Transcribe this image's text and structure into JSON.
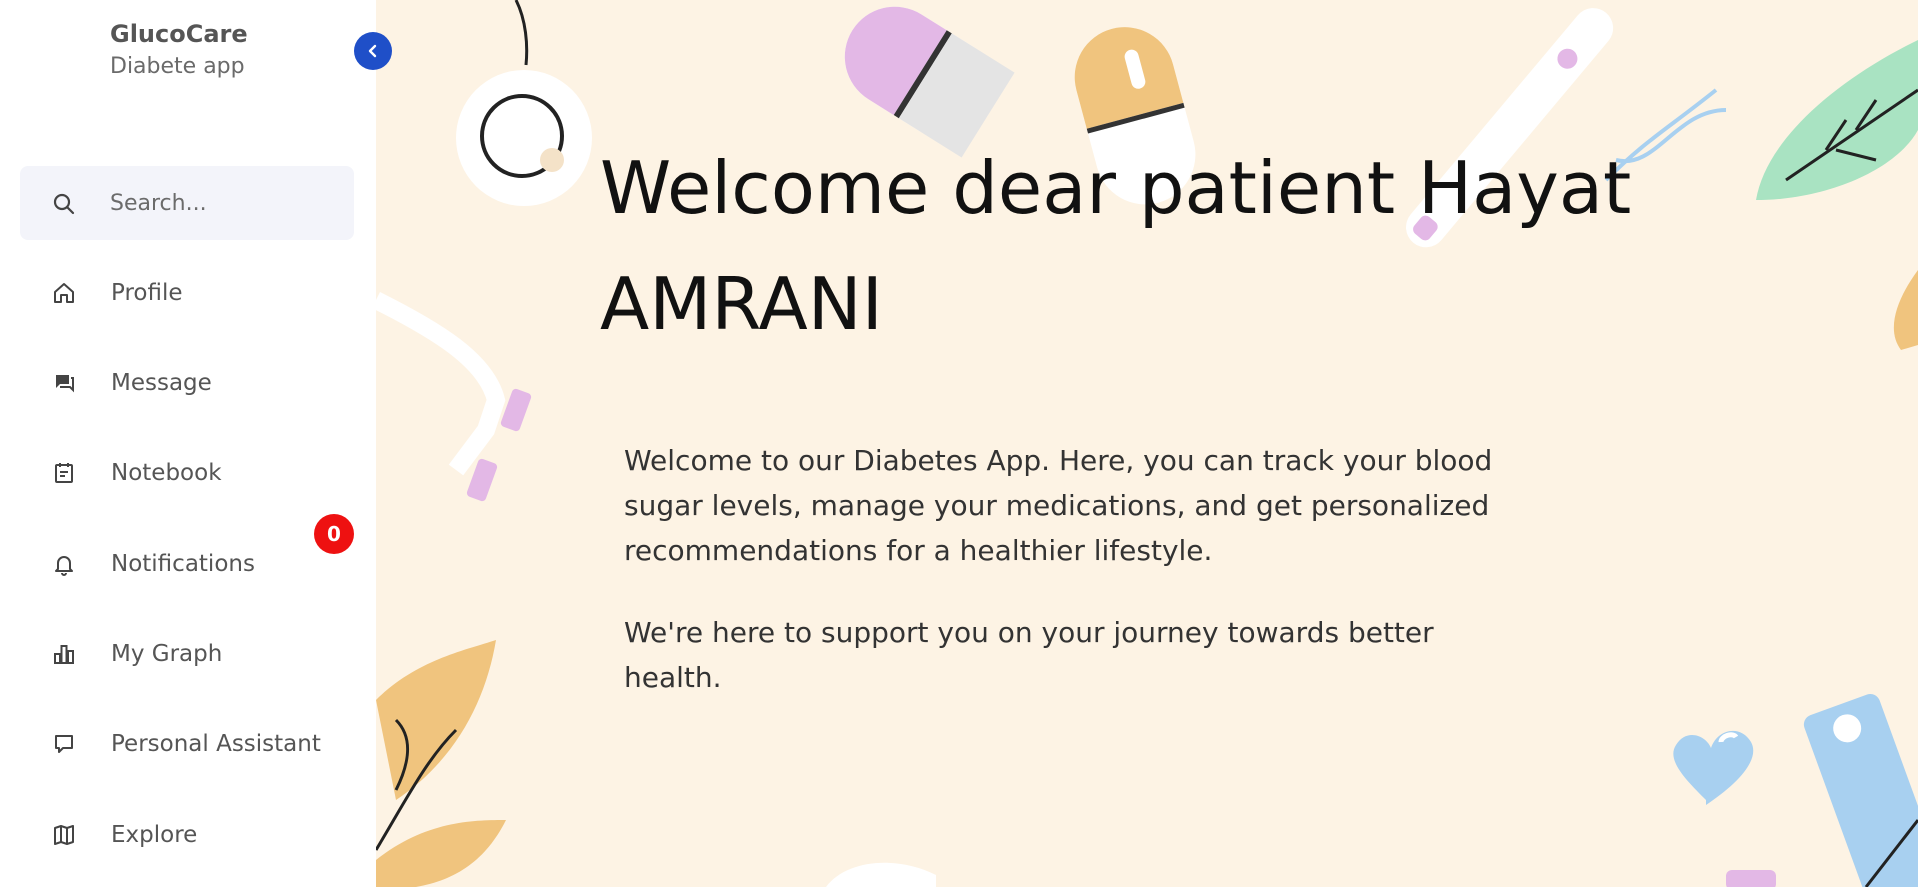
{
  "app": {
    "name": "GlucoCare",
    "subtitle": "Diabete app"
  },
  "search": {
    "placeholder": "Search..."
  },
  "sidebar": {
    "items": [
      {
        "label": "Profile",
        "icon": "home-icon"
      },
      {
        "label": "Message",
        "icon": "chat-icon"
      },
      {
        "label": "Notebook",
        "icon": "notebook-icon"
      },
      {
        "label": "Notifications",
        "icon": "bell-icon",
        "badge": "0"
      },
      {
        "label": "My Graph",
        "icon": "bar-chart-icon"
      },
      {
        "label": "Personal Assistant",
        "icon": "speech-bubble-icon"
      },
      {
        "label": "Explore",
        "icon": "map-icon"
      }
    ]
  },
  "main": {
    "title": "Welcome dear patient Hayat AMRANI",
    "paragraphs": [
      "Welcome to our Diabetes App. Here, you can track your blood sugar levels, manage your medications, and get personalized recommendations for a healthier lifestyle.",
      "We're here to support you on your journey towards better health."
    ]
  },
  "colors": {
    "accent": "#1f4fc8",
    "badge": "#ee1111",
    "background": "#fdf3e4"
  }
}
